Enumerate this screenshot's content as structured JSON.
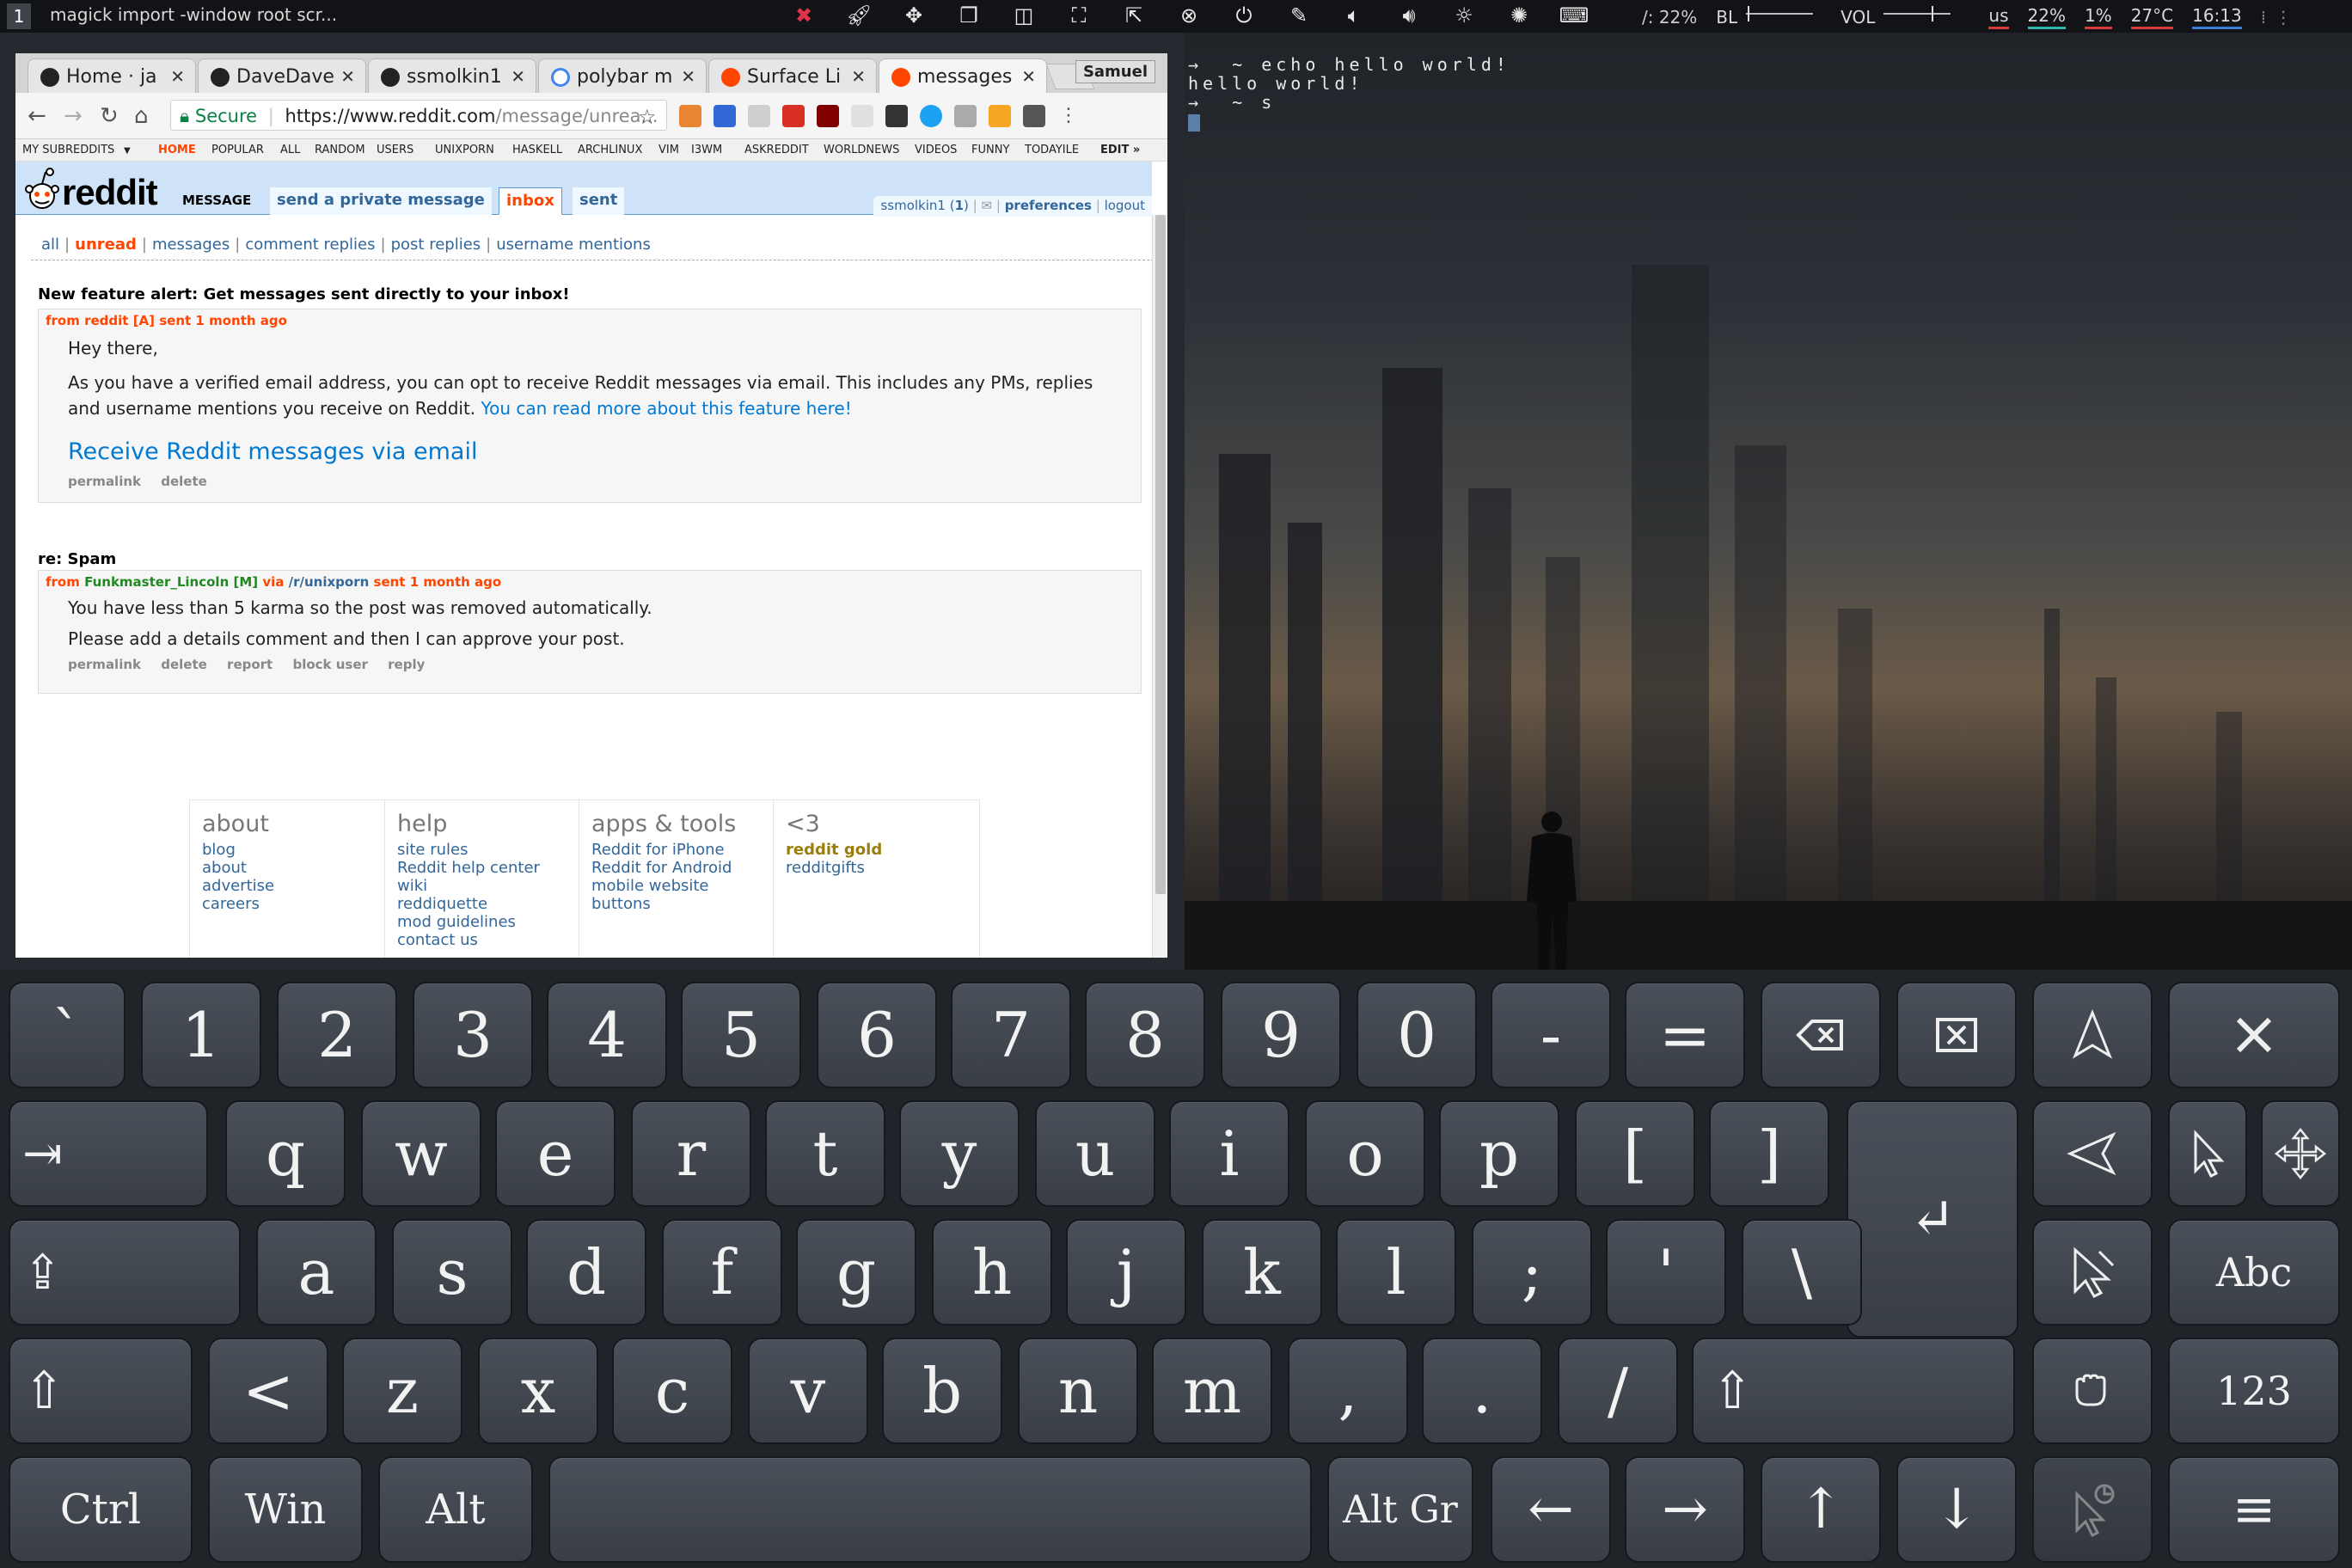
{
  "topbar": {
    "workspace": "1",
    "window_title": "magick import -window root scr...",
    "icons": [
      "close-red-icon",
      "rocket-icon",
      "move-icon",
      "windows-icon",
      "split-icon",
      "fullscreen-icon",
      "share-icon",
      "close-circle-icon",
      "power-icon",
      "edit-icon",
      "volume-low-icon",
      "volume-high-icon",
      "brightness-down-icon",
      "brightness-up-icon",
      "keyboard-icon"
    ],
    "disk": "/: 22%",
    "bl_label": "BL",
    "vol_label": "VOL",
    "layout": "us",
    "battery": "22%",
    "cpu": "1%",
    "temp": "27°C",
    "time": "16:13",
    "colors": {
      "battery": "#2ab7a9",
      "cpu": "#d43b3b",
      "time": "#3a7bd5"
    }
  },
  "browser": {
    "tabs": [
      {
        "title": "Home · ja",
        "icon": "github-icon"
      },
      {
        "title": "DaveDave",
        "icon": "github-icon"
      },
      {
        "title": "ssmolkin1",
        "icon": "github-icon"
      },
      {
        "title": "polybar m",
        "icon": "google-icon"
      },
      {
        "title": "Surface Li",
        "icon": "reddit-icon"
      },
      {
        "title": "messages",
        "icon": "reddit-icon"
      }
    ],
    "profile": "Samuel",
    "secure_label": "Secure",
    "url_host": "https://www.reddit.com",
    "url_path": "/message/unrea...",
    "subreddit_bar": {
      "my_subreddits": "MY SUBREDDITS",
      "items": [
        "HOME",
        "POPULAR",
        "ALL",
        "RANDOM",
        "USERS",
        "UNIXPORN",
        "HASKELL",
        "ARCHLINUX",
        "VIM",
        "I3WM",
        "ASKREDDIT",
        "WORLDNEWS",
        "VIDEOS",
        "FUNNY",
        "TODAYILE"
      ],
      "edit": "EDIT »"
    }
  },
  "reddit": {
    "wordmark": "reddit",
    "page_name": "MESSAGE",
    "tabs": [
      {
        "label": "send a private message",
        "selected": false
      },
      {
        "label": "inbox",
        "selected": true
      },
      {
        "label": "sent",
        "selected": false
      }
    ],
    "user": "ssmolkin1",
    "karma": "1",
    "preferences": "preferences",
    "logout": "logout",
    "menu": [
      "all",
      "unread",
      "messages",
      "comment replies",
      "post replies",
      "username mentions"
    ],
    "messages": [
      {
        "subject": "New feature alert: Get messages sent directly to your inbox!",
        "from_prefix": "from",
        "author": "reddit",
        "flair": "[A]",
        "sent": "sent 1 month ago",
        "greeting": "Hey there,",
        "body": "As you have a verified email address, you can opt to receive Reddit messages via email. This includes any PMs, replies and username mentions you receive on Reddit.",
        "body_link": "You can read more about this feature here!",
        "cta": "Receive Reddit messages via email",
        "buttons": [
          "permalink",
          "delete"
        ]
      },
      {
        "subject": "re: Spam",
        "from_prefix": "from",
        "author": "Funkmaster_Lincoln",
        "flair": "[M]",
        "via": "via",
        "subreddit": "/r/unixporn",
        "sent": "sent 1 month ago",
        "line1": "You have less than 5 karma so the post was removed automatically.",
        "line2": "Please add a details comment and then I can approve your post.",
        "buttons": [
          "permalink",
          "delete",
          "report",
          "block user",
          "reply"
        ]
      }
    ],
    "footer": [
      {
        "title": "about",
        "links": [
          "blog",
          "about",
          "advertise",
          "careers"
        ]
      },
      {
        "title": "help",
        "links": [
          "site rules",
          "Reddit help center",
          "wiki",
          "reddiquette",
          "mod guidelines",
          "contact us"
        ]
      },
      {
        "title": "apps & tools",
        "links": [
          "Reddit for iPhone",
          "Reddit for Android",
          "mobile website",
          "buttons"
        ]
      },
      {
        "title": "<3",
        "links": [
          "reddit gold",
          "redditgifts"
        ]
      }
    ]
  },
  "terminal": {
    "line1": "→  ~ echo hello world!",
    "line2": "hello world!",
    "line3": "→  ~ s"
  },
  "keyboard": {
    "row1": [
      "`",
      "1",
      "2",
      "3",
      "4",
      "5",
      "6",
      "7",
      "8",
      "9",
      "0",
      "-",
      "="
    ],
    "row2": [
      "q",
      "w",
      "e",
      "r",
      "t",
      "y",
      "u",
      "i",
      "o",
      "p",
      "[",
      "]"
    ],
    "row3": [
      "a",
      "s",
      "d",
      "f",
      "g",
      "h",
      "j",
      "k",
      "l",
      ";",
      "'",
      "\\"
    ],
    "row4": [
      "<",
      "z",
      "x",
      "c",
      "v",
      "b",
      "n",
      "m",
      ",",
      ".",
      "/"
    ],
    "mods": {
      "ctrl": "Ctrl",
      "win": "Win",
      "alt": "Alt",
      "altgr": "Alt Gr",
      "abc": "Abc",
      "num": "123"
    },
    "glyphs": {
      "tab": "⇥",
      "caps": "⇪",
      "shift": "⇧",
      "enter": "↵",
      "left": "←",
      "right": "→",
      "up": "↑",
      "down": "↓",
      "menu": "≡"
    }
  }
}
